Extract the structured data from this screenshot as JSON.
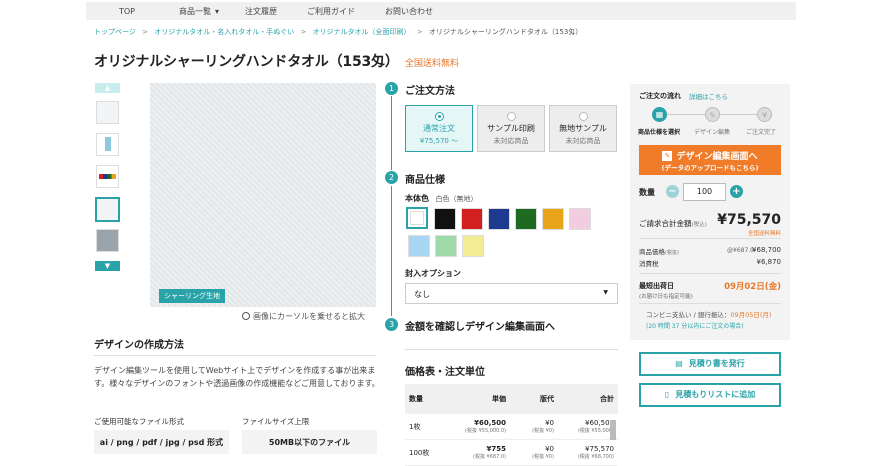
{
  "nav": {
    "items": [
      "TOP",
      "商品一覧",
      "注文履歴",
      "ご利用ガイド",
      "お問い合わせ"
    ],
    "dropdown_glyph": "▾"
  },
  "breadcrumb": [
    "トップページ",
    ">",
    "オリジナルタオル・名入れタオル・手ぬぐい",
    ">",
    "オリジナルタオル（全面印刷）",
    ">",
    "オリジナルシャーリングハンドタオル（153匁）"
  ],
  "product": {
    "title": "オリジナルシャーリングハンドタオル（153匁）",
    "free_shipping": "全国送料無料",
    "image_tag": "シャーリング生地",
    "zoom_note": "画像にカーソルを乗せると拡大"
  },
  "thumb_arrows": {
    "up": "▲",
    "down": "▼"
  },
  "design": {
    "heading": "デザインの作成方法",
    "desc": "デザイン編集ツールを使用してWebサイト上でデザインを作成する事が出来ます。様々なデザインのフォントや透過画像の作成機能などご用意しております。",
    "formats_label": "ご使用可能なファイル形式",
    "formats_value": "ai / png / pdf / jpg / psd 形式",
    "size_label": "ファイルサイズ上限",
    "size_value": "50MB以下のファイル"
  },
  "steps": {
    "s1_num": "1",
    "s1_title": "ご注文方法",
    "s2_num": "2",
    "s2_title": "商品仕様",
    "s3_num": "3",
    "s3_title": "金額を確認しデザイン編集画面へ"
  },
  "order_options": [
    {
      "label": "通常注文",
      "sub": "¥75,570 〜"
    },
    {
      "label": "サンプル印刷",
      "sub": "未対応商品"
    },
    {
      "label": "無地サンプル",
      "sub": "未対応商品"
    }
  ],
  "spec": {
    "body_color_label": "本体色",
    "body_color_value": "白色（無地）",
    "swatches": [
      "#ffffff",
      "#111111",
      "#d21f1f",
      "#1d3a8f",
      "#1e6a20",
      "#e8a51a",
      "#f2cde0",
      "#a8d6f2",
      "#9ed9a8",
      "#f2ec94"
    ],
    "wrap_label": "封入オプション",
    "wrap_value": "なし",
    "wrap_caret": "▼"
  },
  "price_table": {
    "heading": "価格表・注文単位",
    "headers": [
      "数量",
      "単価",
      "版代",
      "合計"
    ],
    "rows": [
      {
        "qty": "1枚",
        "unit": "¥60,500",
        "unit_tax": "(税抜 ¥55,000.0)",
        "plate": "¥0",
        "plate_tax": "(税抜 ¥0)",
        "total": "¥60,500",
        "total_tax": "(税抜 ¥55,000)"
      },
      {
        "qty": "100枚",
        "unit": "¥755",
        "unit_tax": "(税抜 ¥687.0)",
        "plate": "¥0",
        "plate_tax": "(税抜 ¥0)",
        "total": "¥75,570",
        "total_tax": "(税抜 ¥68,700)"
      }
    ]
  },
  "panel": {
    "flow_title": "ご注文の流れ",
    "flow_link": "詳細はこちら",
    "flow_steps": [
      "商品仕様を選択",
      "デザイン編集",
      "ご注文完了"
    ],
    "flow_icon_1": "▦",
    "flow_icon_2": "✎",
    "flow_icon_3": "¥",
    "edit_btn": "デザイン編集画面へ",
    "edit_btn_sub": "(データのアップロードもこちら)",
    "edit_icon": "✎",
    "qty_label": "数量",
    "qty_value": "100",
    "minus": "−",
    "plus": "+",
    "total_label": "ご請求合計金額",
    "total_tax_note": "(税込)",
    "total_value": "¥75,570",
    "total_free": "全国送料無料",
    "price_label": "商品価格",
    "price_note": "(税抜)",
    "price_unit": "@¥687.0",
    "price_value": "¥68,700",
    "tax_label": "消費税",
    "tax_value": "¥6,870",
    "ship_label": "最短出荷日",
    "ship_sub": "(お届け日も指定可能)",
    "ship_value": "09月02日(金)",
    "conv_note": "コンビニ支払い / 銀行振込：",
    "conv_date": "09月05日(月)",
    "conv_sub": "(20 時間 37 分以内にご注文の場合)",
    "quote_btn": "見積り書を発行",
    "list_btn": "見積もりリストに追加",
    "doc_icon": "▤",
    "bookmark_icon": "▯"
  },
  "colors": {
    "accent": "#2aa3a8",
    "orange": "#f07b28"
  }
}
